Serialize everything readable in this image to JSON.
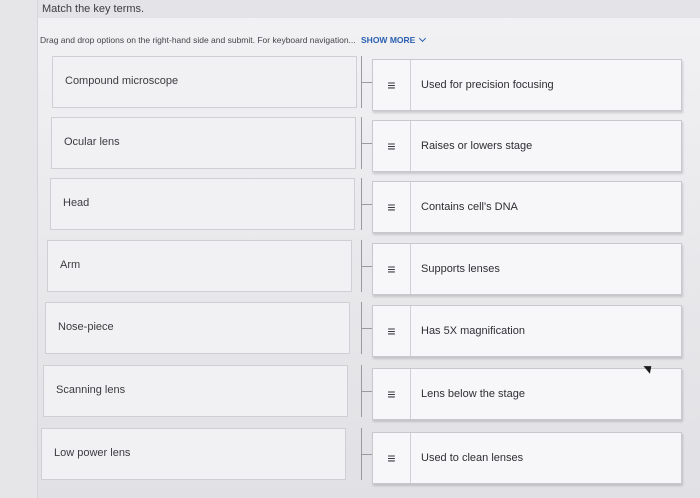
{
  "header": {
    "title": "Match the key terms.",
    "instructions": "Drag and drop options on the right-hand side and submit. For keyboard navigation...",
    "show_more": "SHOW MORE"
  },
  "terms": [
    "Compound microscope",
    "Ocular lens",
    "Head",
    "Arm",
    "Nose-piece",
    "Scanning lens",
    "Low power lens"
  ],
  "options": [
    "Used for precision focusing",
    "Raises or lowers stage",
    "Contains cell's DNA",
    "Supports lenses",
    "Has 5X magnification",
    "Lens below the stage",
    "Used to clean lenses"
  ],
  "icons": {
    "drag_handle": "drag-handle-icon",
    "show_more": "chevron-down-icon"
  },
  "colors": {
    "link": "#2a5fb0",
    "background": "#e9e9ec"
  }
}
